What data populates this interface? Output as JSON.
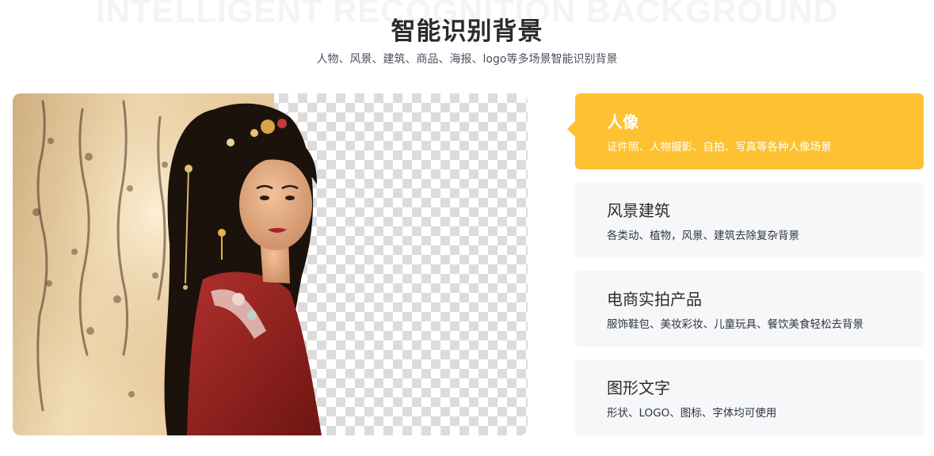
{
  "header": {
    "background_text": "INTELLIGENT RECOGNITION BACKGROUND",
    "title": "智能识别背景",
    "subtitle": "人物、风景、建筑、商品、海报、logo等多场景智能识别背景"
  },
  "cards": [
    {
      "title": "人像",
      "desc": "证件照、人物摄影、自拍、写真等各种人像场景",
      "active": true
    },
    {
      "title": "风景建筑",
      "desc": "各类动、植物，风景、建筑去除复杂背景",
      "active": false
    },
    {
      "title": "电商实拍产品",
      "desc": "服饰鞋包、美妆彩妆、儿童玩具、餐饮美食轻松去背景",
      "active": false
    },
    {
      "title": "图形文字",
      "desc": "形状、LOGO、图标、字体均可使用",
      "active": false
    }
  ],
  "colors": {
    "accent": "#fdc132",
    "card_bg": "#f6f7f9",
    "title": "#2b2b2b"
  }
}
